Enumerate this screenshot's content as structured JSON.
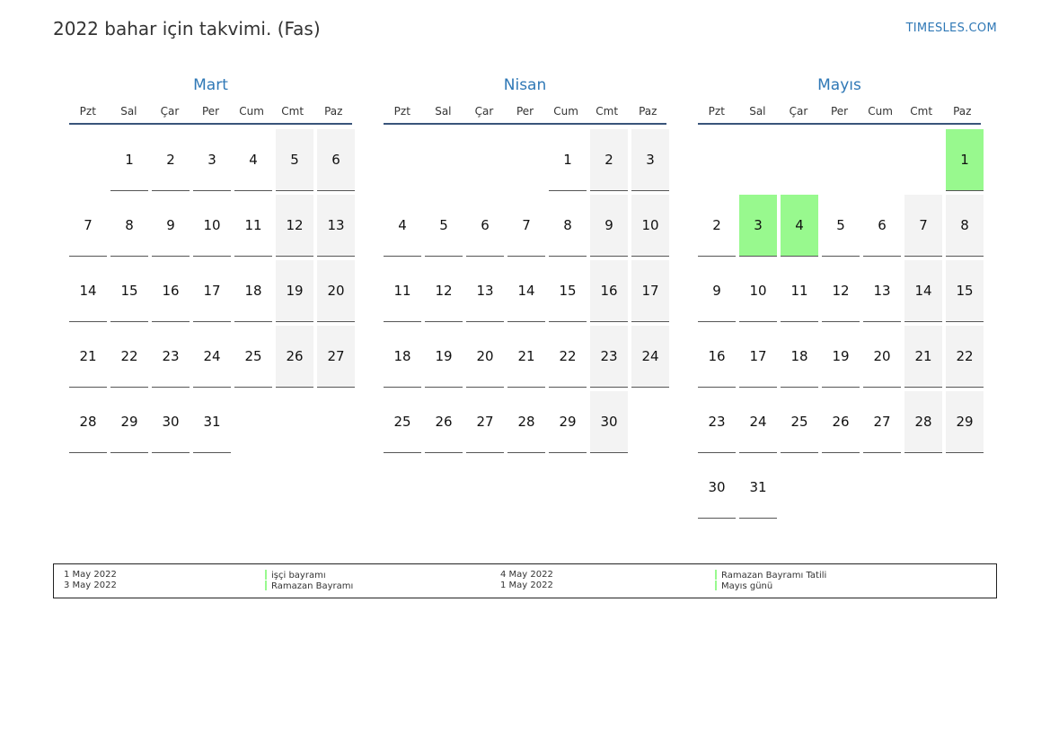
{
  "header": {
    "title": "2022 bahar için takvimi. (Fas)",
    "site": "TIMESLES.COM"
  },
  "weekdays": [
    "Pzt",
    "Sal",
    "Çar",
    "Per",
    "Cum",
    "Cmt",
    "Paz"
  ],
  "colors": {
    "accent": "#2f78b6",
    "weekend": "#f3f3f3",
    "holiday": "#98f98e"
  },
  "months": [
    {
      "name": "Mart",
      "days": [
        "",
        "1",
        "2",
        "3",
        "4",
        "5",
        "6",
        "7",
        "8",
        "9",
        "10",
        "11",
        "12",
        "13",
        "14",
        "15",
        "16",
        "17",
        "18",
        "19",
        "20",
        "21",
        "22",
        "23",
        "24",
        "25",
        "26",
        "27",
        "28",
        "29",
        "30",
        "31"
      ],
      "holidays": []
    },
    {
      "name": "Nisan",
      "days": [
        "",
        "",
        "",
        "",
        "1",
        "2",
        "3",
        "4",
        "5",
        "6",
        "7",
        "8",
        "9",
        "10",
        "11",
        "12",
        "13",
        "14",
        "15",
        "16",
        "17",
        "18",
        "19",
        "20",
        "21",
        "22",
        "23",
        "24",
        "25",
        "26",
        "27",
        "28",
        "29",
        "30"
      ],
      "holidays": []
    },
    {
      "name": "Mayıs",
      "days": [
        "",
        "",
        "",
        "",
        "",
        "",
        "1",
        "2",
        "3",
        "4",
        "5",
        "6",
        "7",
        "8",
        "9",
        "10",
        "11",
        "12",
        "13",
        "14",
        "15",
        "16",
        "17",
        "18",
        "19",
        "20",
        "21",
        "22",
        "23",
        "24",
        "25",
        "26",
        "27",
        "28",
        "29",
        "30",
        "31"
      ],
      "holidays": [
        "1",
        "3",
        "4"
      ]
    }
  ],
  "legend": [
    {
      "date": "1 May 2022",
      "name": "işçi bayramı"
    },
    {
      "date": "3 May 2022",
      "name": "Ramazan Bayramı"
    },
    {
      "date": "4 May 2022",
      "name": "Ramazan Bayramı Tatili"
    },
    {
      "date": "1 May 2022",
      "name": "Mayıs günü"
    }
  ]
}
